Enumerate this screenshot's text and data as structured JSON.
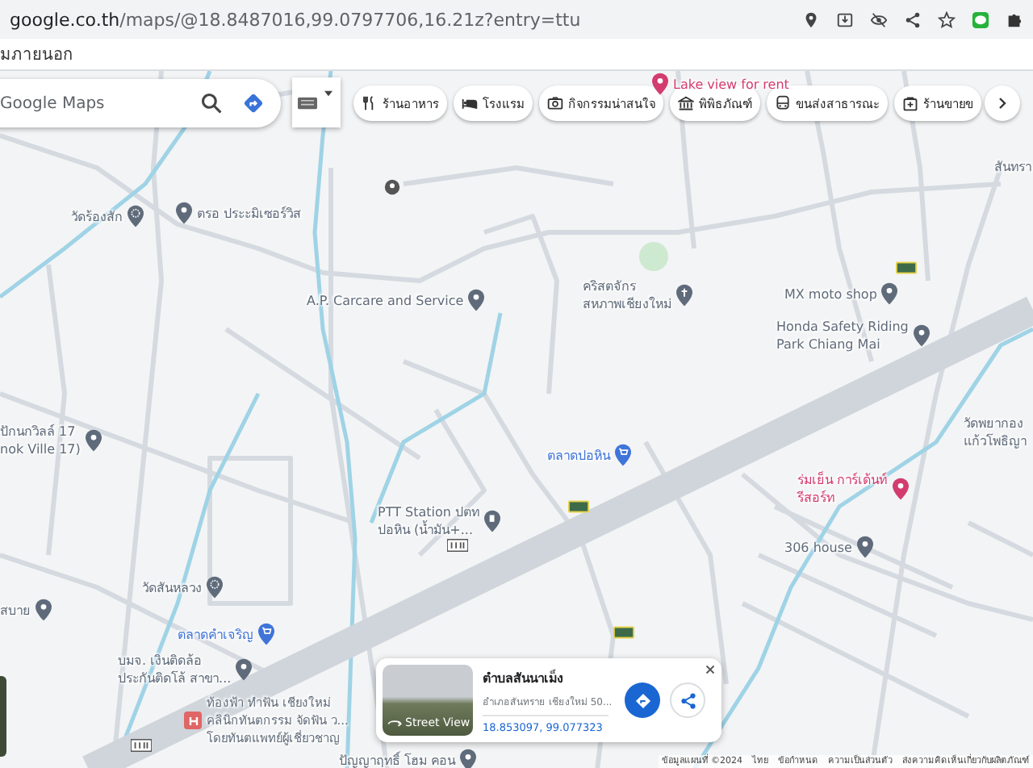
{
  "browser": {
    "url_host": "google.co.th",
    "url_path": "/maps/@18.8487016,99.0797706,16.21z?entry=ttu"
  },
  "bookmarks_bar": {
    "items": [
      "มภายนอก"
    ]
  },
  "search": {
    "placeholder": "Google Maps"
  },
  "categories": [
    {
      "label": "ร้านอาหาร",
      "kind": "restaurant"
    },
    {
      "label": "โรงแรม",
      "kind": "hotel"
    },
    {
      "label": "กิจกรรมน่าสนใจ",
      "kind": "camera"
    },
    {
      "label": "พิพิธภัณฑ์",
      "kind": "museum"
    },
    {
      "label": "ขนส่งสาธารณะ",
      "kind": "transit"
    },
    {
      "label": "ร้านขายข",
      "kind": "shop"
    }
  ],
  "map_labels": [
    {
      "text": "Lake view for rent",
      "kind": "pin",
      "color": "#d33c6e"
    },
    {
      "text": "สันทรา",
      "kind": "area",
      "color": "#5f6b7a"
    },
    {
      "text": "วัดร้องสัก",
      "kind": "temple",
      "color": "#5f6b7a"
    },
    {
      "text": "ตรอ ประะมิเซอร์วิส",
      "kind": "pin",
      "color": "#5f6b7a"
    },
    {
      "text": "A.P. Carcare and Service",
      "kind": "pin",
      "color": "#5f6b7a"
    },
    {
      "text": "คริสตจักร\nสหภาพเชียงใหม่",
      "kind": "church",
      "color": "#5f6b7a"
    },
    {
      "text": "MX moto shop",
      "kind": "pin",
      "color": "#5f6b7a"
    },
    {
      "text": "Honda Safety Riding\nPark Chiang Mai",
      "kind": "pin",
      "color": "#5f6b7a"
    },
    {
      "text": "วัดพยากอง\nแก้วโพธิญา",
      "kind": "area",
      "color": "#5f6b7a"
    },
    {
      "text": "ปักนกวิลล์ 17\nnok Ville 17)",
      "kind": "pin",
      "color": "#5f6b7a"
    },
    {
      "text": "PTT Station ปตท\nปอหิน (น้ำมัน+...",
      "kind": "gas",
      "color": "#5f6b7a"
    },
    {
      "text": "ตลาดปอหิน",
      "kind": "shop",
      "color": "#3f74d9"
    },
    {
      "text": "ร่มเย็น การ์เด้นท์\nรีสอร์ท",
      "kind": "pin",
      "color": "#d33c6e"
    },
    {
      "text": "306 house",
      "kind": "pin",
      "color": "#5f6b7a"
    },
    {
      "text": "วัดสันหลวง",
      "kind": "temple",
      "color": "#5f6b7a"
    },
    {
      "text": "สบาย",
      "kind": "pin",
      "color": "#5f6b7a"
    },
    {
      "text": "ตลาดคำเจริญ",
      "kind": "shop",
      "color": "#3f74d9"
    },
    {
      "text": "บมจ. เงินติดล้อ\nประกันติดโล้ สาขา...",
      "kind": "pin",
      "color": "#5f6b7a"
    },
    {
      "text": "ท้องฟ้า ทำฟัน เชียงใหม่\nคลินิกทันตกรรม จัดฟัน ว...\nโดยทันตแพทย์ผู้เชี่ยวชาญ",
      "kind": "hospital",
      "color": "#e06666"
    },
    {
      "text": "ปัญญาฤทธิ์ โฮม คอน",
      "kind": "pin",
      "color": "#5f6b7a"
    }
  ],
  "place_card": {
    "title": "ตำบลสันนาเม็ง",
    "subtitle": "อำเภอสันทราย เชียงใหม่ 50...",
    "coordinates": "18.853097, 99.077323",
    "photo_label": "Street View"
  },
  "footer_links": [
    "ข้อมูลแผนที่ ©2024",
    "ไทย",
    "ข้อกำหนด",
    "ความเป็นส่วนตัว",
    "ส่งความคิดเห็นเกี่ยวกับผลิตภัณฑ์"
  ]
}
